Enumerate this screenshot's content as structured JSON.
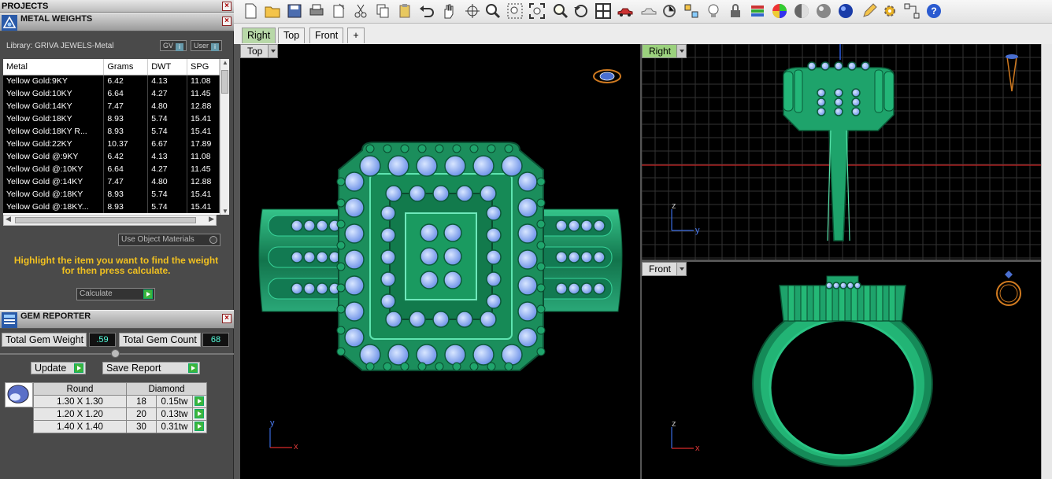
{
  "projects": {
    "title": "PROJECTS"
  },
  "metal_weights": {
    "title": "METAL WEIGHTS",
    "library": "Library: GRIVA JEWELS-Metal",
    "gv_label": "GV",
    "user_label": "User",
    "columns": [
      "Metal",
      "Grams",
      "DWT",
      "SPG"
    ],
    "rows": [
      [
        "Yellow Gold:9KY",
        "6.42",
        "4.13",
        "11.08"
      ],
      [
        "Yellow Gold:10KY",
        "6.64",
        "4.27",
        "11.45"
      ],
      [
        "Yellow Gold:14KY",
        "7.47",
        "4.80",
        "12.88"
      ],
      [
        "Yellow Gold:18KY",
        "8.93",
        "5.74",
        "15.41"
      ],
      [
        "Yellow Gold:18KY R...",
        "8.93",
        "5.74",
        "15.41"
      ],
      [
        "Yellow Gold:22KY",
        "10.37",
        "6.67",
        "17.89"
      ],
      [
        "Yellow Gold @:9KY",
        "6.42",
        "4.13",
        "11.08"
      ],
      [
        "Yellow Gold @:10KY",
        "6.64",
        "4.27",
        "11.45"
      ],
      [
        "Yellow Gold @:14KY",
        "7.47",
        "4.80",
        "12.88"
      ],
      [
        "Yellow Gold @:18KY",
        "8.93",
        "5.74",
        "15.41"
      ],
      [
        "Yellow Gold @:18KY...",
        "8.93",
        "5.74",
        "15.41"
      ]
    ],
    "use_object_materials": "Use Object Materials",
    "hint": "Highlight the item you want to find the weight for then press calculate.",
    "calculate": "Calculate"
  },
  "gem_reporter": {
    "title": "GEM REPORTER",
    "total_weight_label": "Total Gem Weight",
    "total_weight_value": ".59",
    "total_count_label": "Total Gem Count",
    "total_count_value": "68",
    "update_label": "Update",
    "save_report_label": "Save Report",
    "shape": "Round",
    "material": "Diamond",
    "gems": [
      {
        "size": "1.30 X 1.30",
        "count": "18",
        "weight": "0.15tw"
      },
      {
        "size": "1.20 X 1.20",
        "count": "20",
        "weight": "0.13tw"
      },
      {
        "size": "1.40 X 1.40",
        "count": "30",
        "weight": "0.31tw"
      }
    ]
  },
  "tabs": [
    "Right",
    "Top",
    "Front"
  ],
  "viewports": {
    "top": {
      "label": "Top",
      "axis_v": "y",
      "axis_h": "x"
    },
    "right": {
      "label": "Right",
      "axis_v": "z",
      "axis_h": "y"
    },
    "front": {
      "label": "Front",
      "axis_v": "z",
      "axis_h": "x"
    }
  },
  "colors": {
    "ring_green": "#1f9a6a",
    "gem_blue": "#8fb6ff",
    "panel_bg": "#4a4a4a",
    "hint_yellow": "#f0c020"
  }
}
